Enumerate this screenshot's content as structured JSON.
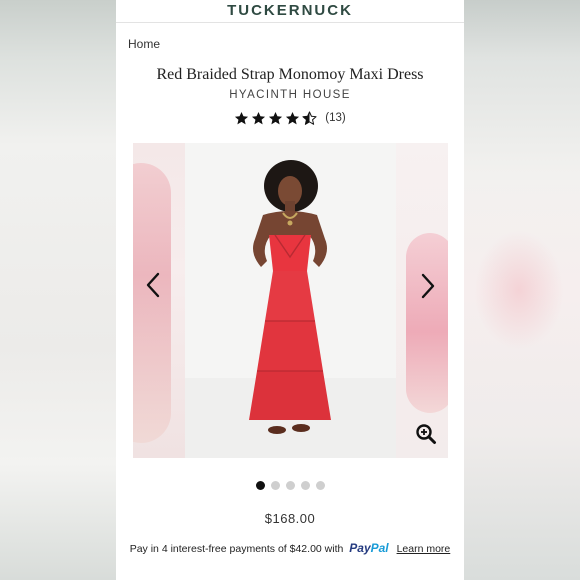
{
  "brand": "TUCKERNUCK",
  "breadcrumb": "Home",
  "product": {
    "title": "Red Braided Strap Monomoy Maxi Dress",
    "vendor": "HYACINTH HOUSE",
    "rating": 4.5,
    "review_count": "(13)",
    "price": "$168.00"
  },
  "gallery": {
    "slide_count": 5,
    "active_index": 0
  },
  "paypal": {
    "prefix": "Pay in 4 interest-free payments of $42.00 with",
    "logo_pay": "Pay",
    "logo_pal": "Pal",
    "link": "Learn more"
  },
  "icons": {
    "prev": "chevron-left-icon",
    "next": "chevron-right-icon",
    "zoom": "zoom-in-icon",
    "star": "star-icon"
  },
  "colors": {
    "brand": "#2f4a42",
    "dress": "#e8353f",
    "paypal_dark": "#253b80",
    "paypal_light": "#179bd7"
  }
}
